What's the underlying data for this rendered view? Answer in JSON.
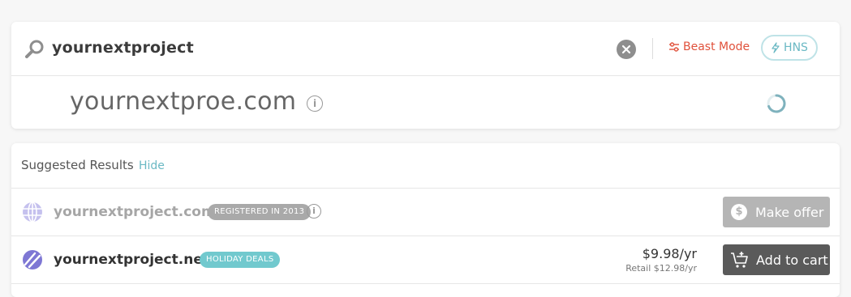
{
  "search": {
    "query": "yournextproject",
    "beast_mode_label": "Beast Mode",
    "hns_label": "HNS"
  },
  "domain_check": {
    "domain": "yournextproe.com",
    "info_glyph": "i"
  },
  "suggested": {
    "title": "Suggested Results",
    "hide_label": "Hide",
    "results": [
      {
        "domain": "yournextproject.com",
        "badge": "REGISTERED IN 2013",
        "info_glyph": "i",
        "offer_glyph": "$",
        "action_label": "Make offer",
        "icon": "globe-icon"
      },
      {
        "domain": "yournextproject.net",
        "badge": "HOLIDAY DEALS",
        "price": "$9.98/yr",
        "retail": "Retail $12.98/yr",
        "action_label": "Add to cart",
        "icon": "net-tld-icon"
      }
    ]
  },
  "colors": {
    "accent_teal": "#6bb9c4",
    "beast_red": "#e0513b",
    "badge_teal": "#71c9ce",
    "globe_purple": "#8d86d9"
  }
}
